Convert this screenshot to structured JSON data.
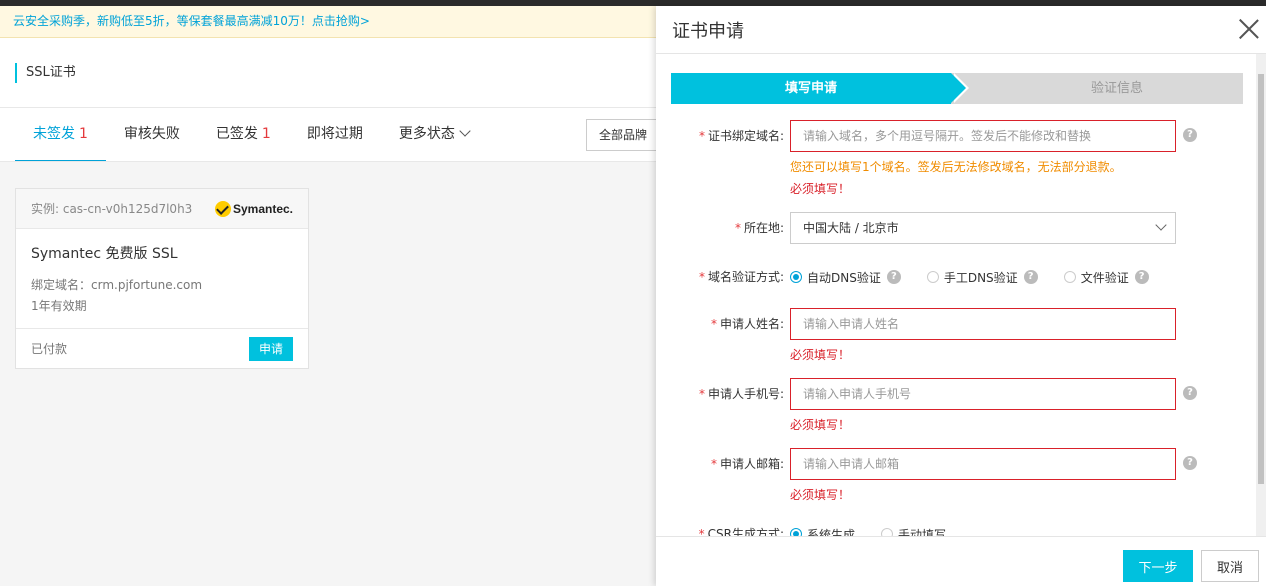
{
  "promo": {
    "text": "云安全采购季，新购低至5折，等保套餐最高满减10万！点击抢购>"
  },
  "page": {
    "title": "SSL证书",
    "brand_filter": "全部品牌"
  },
  "tabs": [
    {
      "label": "未签发",
      "count": "1"
    },
    {
      "label": "审核失败",
      "count": ""
    },
    {
      "label": "已签发",
      "count": "1"
    },
    {
      "label": "即将过期",
      "count": ""
    },
    {
      "label": "更多状态",
      "count": ""
    }
  ],
  "card": {
    "instance": "实例: cas-cn-v0h125d7l0h3",
    "brand_logo_text": "Symantec.",
    "name": "Symantec 免费版 SSL",
    "domain": "绑定域名：crm.pjfortune.com",
    "validity": "1年有效期",
    "status": "已付款",
    "apply_label": "申请"
  },
  "drawer": {
    "title": "证书申请",
    "steps": [
      "填写申请",
      "验证信息"
    ],
    "fields": {
      "domain": {
        "label": "证书绑定域名:",
        "placeholder": "请输入域名，多个用逗号隔开。签发后不能修改和替换",
        "hint": "您还可以填写1个域名。签发后无法修改域名，无法部分退款。",
        "error": "必须填写！"
      },
      "location": {
        "label": "所在地:",
        "value": "中国大陆 / 北京市"
      },
      "verify": {
        "label": "域名验证方式:",
        "options": [
          "自动DNS验证",
          "手工DNS验证",
          "文件验证"
        ]
      },
      "name": {
        "label": "申请人姓名:",
        "placeholder": "请输入申请人姓名",
        "error": "必须填写！"
      },
      "phone": {
        "label": "申请人手机号:",
        "placeholder": "请输入申请人手机号",
        "error": "必须填写！"
      },
      "email": {
        "label": "申请人邮箱:",
        "placeholder": "请输入申请人邮箱",
        "error": "必须填写！"
      },
      "csr": {
        "label": "CSR生成方式:",
        "options": [
          "系统生成",
          "手动填写"
        ]
      }
    },
    "help_glyph": "?",
    "buttons": {
      "next": "下一步",
      "cancel": "取消"
    }
  },
  "colors": {
    "accent": "#00c1de",
    "link": "#00a2d8",
    "error": "#d9212a",
    "warning": "#f08c00"
  }
}
